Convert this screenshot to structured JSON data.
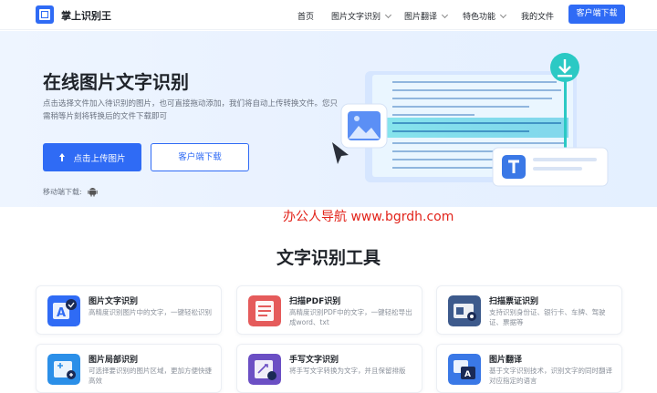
{
  "nav": {
    "brand": "掌上识别王",
    "items": [
      {
        "label": "首页"
      },
      {
        "label": "图片文字识别"
      },
      {
        "label": "图片翻译"
      },
      {
        "label": "特色功能"
      },
      {
        "label": "我的文件"
      }
    ],
    "client_button": "客户端下载"
  },
  "hero": {
    "title": "在线图片文字识别",
    "description": "点击选择文件加入待识别的图片，也可直接拖动添加，我们将自动上传转换文件。您只需稍等片刻将转换后的文件下载即可",
    "upload_button": "点击上传图片",
    "client_button": "客户端下载",
    "mobile_label": "移动端下载:"
  },
  "watermark": "办公人导航 www.bgrdh.com",
  "tools": {
    "title": "文字识别工具",
    "cards": [
      {
        "title": "图片文字识别",
        "desc": "高精度识别图片中的文字，一键轻松识别",
        "color": "#2f6bf5"
      },
      {
        "title": "扫描PDF识别",
        "desc": "高精度识别PDF中的文字，一键轻松导出成word、txt",
        "color": "#e55b5b"
      },
      {
        "title": "扫描票证识别",
        "desc": "支持识别身份证、银行卡、车牌、驾驶证、票据等",
        "color": "#3d5a8c"
      },
      {
        "title": "图片局部识别",
        "desc": "可选择要识别的图片区域，更加方便快捷高效",
        "color": "#2b8fe8"
      },
      {
        "title": "手写文字识别",
        "desc": "将手写文字转换为文字，并且保留排版",
        "color": "#6b4fc4"
      },
      {
        "title": "图片翻译",
        "desc": "基于文字识别技术，识别文字的同时翻译对应指定的语言",
        "color": "#3a78e6"
      }
    ]
  },
  "colors": {
    "primary": "#2f6bf5",
    "accent_teal": "#20c9c0"
  }
}
